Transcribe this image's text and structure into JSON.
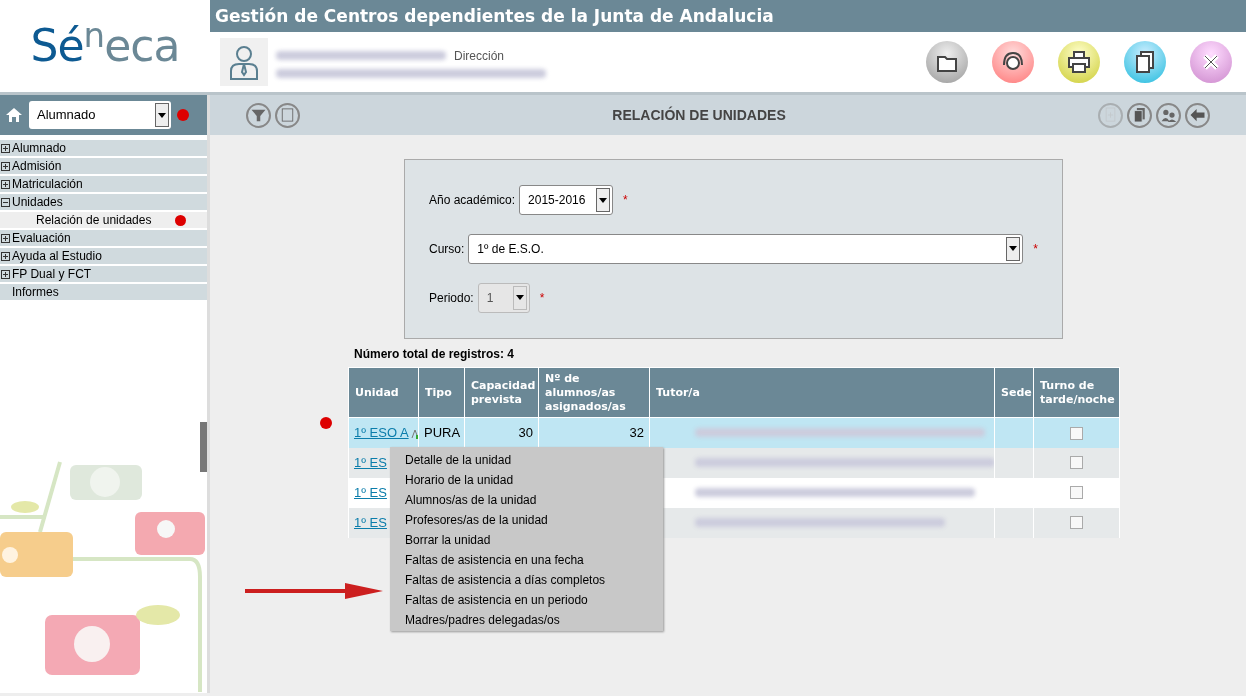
{
  "logo": {
    "parts": [
      "Sé",
      "n",
      "eca"
    ]
  },
  "header": {
    "title": "Gestión de Centros dependientes de la Junta de Andalucia",
    "role": "Dirección"
  },
  "sidebar": {
    "select": {
      "value": "Alumnado"
    },
    "items": [
      {
        "label": "Alumnado",
        "kind": "group",
        "expanded": false,
        "selected": false
      },
      {
        "label": "Admisión",
        "kind": "group",
        "expanded": false,
        "selected": false
      },
      {
        "label": "Matriculación",
        "kind": "group",
        "expanded": false,
        "selected": false
      },
      {
        "label": "Unidades",
        "kind": "group",
        "expanded": true,
        "selected": false,
        "children": [
          {
            "label": "Relación de unidades",
            "kind": "link",
            "selected": true
          }
        ]
      },
      {
        "label": "Evaluación",
        "kind": "group",
        "expanded": false,
        "selected": false
      },
      {
        "label": "Ayuda al Estudio",
        "kind": "group",
        "expanded": false,
        "selected": false
      },
      {
        "label": "FP Dual y FCT",
        "kind": "group",
        "expanded": false,
        "selected": false
      },
      {
        "label": "Informes",
        "kind": "link",
        "selected": false
      }
    ]
  },
  "page_title": "RELACIÓN DE UNIDADES",
  "form": {
    "fields": [
      {
        "label": "Año académico:",
        "value": "2015-2016",
        "required": "*",
        "disabled": false
      },
      {
        "label": "Curso:",
        "value": "1º de E.S.O.",
        "required": "*",
        "disabled": false
      },
      {
        "label": "Periodo:",
        "value": "1",
        "required": "*",
        "disabled": true
      }
    ]
  },
  "records": "Número total de registros: 4",
  "table": {
    "columns": [
      "Unidad",
      "Tipo",
      "Capacidad prevista",
      "Nº de alumnos/as asignados/as",
      "Tutor/a",
      "Sede",
      "Turno de tarde/noche"
    ],
    "rows": [
      {
        "unidad": "1º ESO A",
        "tipo": "PURA",
        "capacidad": "30",
        "alumnos": "32",
        "selected": true,
        "turno_checked": false
      },
      {
        "unidad": "1º ES",
        "selected": false,
        "turno_checked": false
      },
      {
        "unidad": "1º ES",
        "selected": false,
        "turno_checked": false
      },
      {
        "unidad": "1º ES",
        "selected": false,
        "turno_checked": false
      }
    ]
  },
  "context_menu": {
    "items": [
      "Detalle de la unidad",
      "Horario de la unidad",
      "Alumnos/as de la unidad",
      "Profesores/as de la unidad",
      "Borrar la unidad",
      "Faltas de asistencia en una fecha",
      "Faltas de asistencia a días completos",
      "Faltas de asistencia en un periodo",
      "Madres/padres delegadas/os"
    ]
  }
}
